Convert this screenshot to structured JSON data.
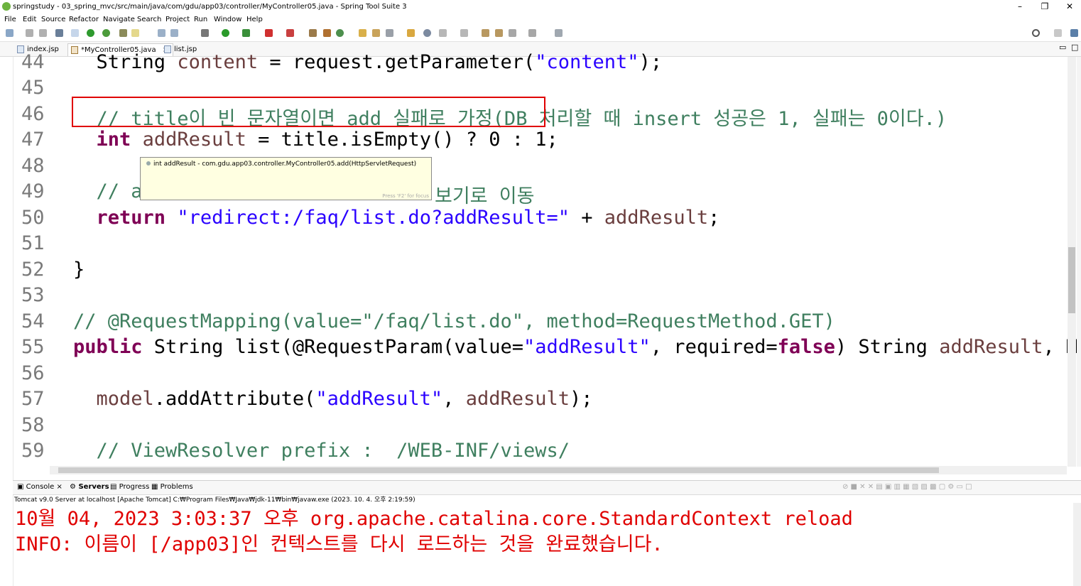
{
  "window": {
    "title": "springstudy - 03_spring_mvc/src/main/java/com/gdu/app03/controller/MyController05.java - Spring Tool Suite 3",
    "minimize": "–",
    "restore": "❐",
    "close": "✕"
  },
  "menu": [
    "File",
    "Edit",
    "Source",
    "Refactor",
    "Navigate",
    "Search",
    "Project",
    "Run",
    "Window",
    "Help"
  ],
  "tabs": [
    {
      "label": "index.jsp"
    },
    {
      "label": "*MyController05.java",
      "close": "×"
    },
    {
      "label": "list.jsp"
    }
  ],
  "editor": {
    "line_numbers": [
      "44",
      "45",
      "46",
      "47",
      "48",
      "49",
      "50",
      "51",
      "52",
      "53",
      "54",
      "55",
      "56",
      "57",
      "58",
      "59"
    ],
    "lines": {
      "l44": {
        "indent": "  ",
        "a": "String",
        "b": " ",
        "c": "content",
        "d": " = request.getParameter(",
        "e": "\"content\"",
        "f": ");"
      },
      "l46": {
        "indent": "  ",
        "comment": "// title이 빈 문자열이면 add 실패로 가정(DB 처리할 때 insert 성공은 1, 실패는 0이다.)"
      },
      "l47": {
        "indent": "  ",
        "kw": "int",
        "b": " ",
        "c": "addResult",
        "d": " = title.isEmpty() ? 0 : 1;"
      },
      "l49": {
        "indent": "  ",
        "comment_start": "// a",
        "comment_end": "보기로 이동"
      },
      "l50": {
        "indent": "  ",
        "kw": "return",
        "b": " ",
        "str": "\"redirect:/faq/list.do?addResult=\"",
        "d": " + ",
        "var": "addResult",
        "e": ";"
      },
      "l52": {
        "text": "}"
      },
      "l54": {
        "comment": "// @RequestMapping(value=\"/faq/list.do\", method=RequestMethod.GET)"
      },
      "l55": {
        "kw": "public",
        "a": " String list(@RequestParam(value=",
        "str": "\"addResult\"",
        "b": ", required=",
        "bool": "false",
        "c": ") String ",
        "var": "addResult",
        "d": ", Mo"
      },
      "l57": {
        "indent": "  ",
        "var1": "model",
        "a": ".addAttribute(",
        "str": "\"addResult\"",
        "b": ", ",
        "var2": "addResult",
        "c": ");"
      },
      "l59": {
        "indent": "  ",
        "comment": "// ViewResolver prefix :  /WEB-INF/views/"
      }
    }
  },
  "tooltip": {
    "text": "int addResult - com.gdu.app03.controller.MyController05.add(HttpServletRequest)",
    "footer": "Press 'F2' for focus"
  },
  "console": {
    "tabs": [
      "Console",
      "Servers",
      "Progress",
      "Problems"
    ],
    "info": "Tomcat v9.0 Server at localhost [Apache Tomcat] C:₩Program Files₩Java₩jdk-11₩bin₩javaw.exe  (2023. 10. 4. 오후 2:19:59)",
    "lines": [
      "10월 04, 2023 3:03:37 오후 org.apache.catalina.core.StandardContext reload",
      "INFO: 이름이 [/app03]인 컨텍스트를 다시 로드하는 것을 완료했습니다."
    ]
  },
  "colors": {
    "keyword": "#7f0055",
    "comment": "#3f7f5f",
    "string": "#2a00ff",
    "variable": "#6a3e3e",
    "console_error": "#e00000",
    "highlight_box": "#e00000"
  }
}
